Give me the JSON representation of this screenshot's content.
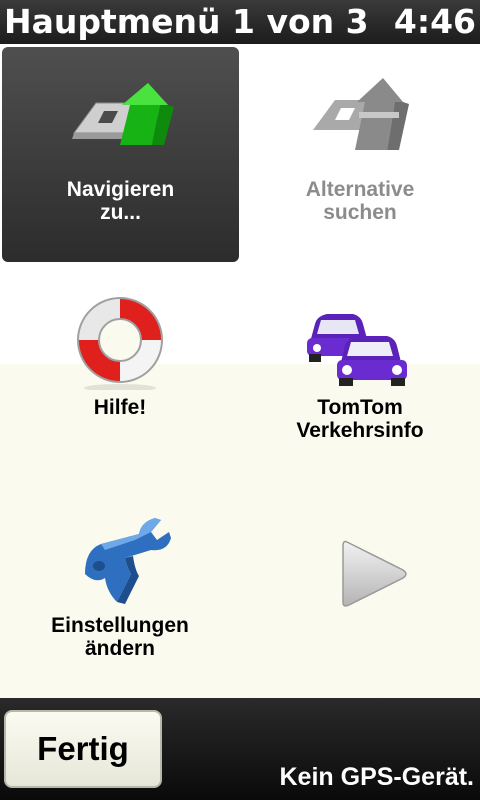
{
  "header": {
    "title": "Hauptmenü 1 von 3",
    "clock": "4:46"
  },
  "menu": {
    "items": [
      {
        "label": "Navigieren\nzu...",
        "icon": "navigate-arrow-icon",
        "state": "selected"
      },
      {
        "label": "Alternative\nsuchen",
        "icon": "alternative-route-icon",
        "state": "disabled"
      },
      {
        "label": "Hilfe!",
        "icon": "lifebuoy-icon",
        "state": "normal"
      },
      {
        "label": "TomTom\nVerkehrsinfo",
        "icon": "traffic-cars-icon",
        "state": "normal"
      },
      {
        "label": "Einstellungen\nändern",
        "icon": "wrench-icon",
        "state": "normal"
      }
    ],
    "next_page_icon": "next-page-arrow-icon"
  },
  "footer": {
    "done_label": "Fertig",
    "gps_status": "Kein GPS-Gerät."
  },
  "colors": {
    "header_bg": "#2a2a2a",
    "selected_tile_bg": "#3e3e3e",
    "navigate_green": "#22c21e",
    "lifebuoy_red": "#e0201c",
    "car_purple": "#6a2bd0",
    "wrench_blue": "#2f6fc0",
    "disabled_grey": "#8c8c8c"
  }
}
